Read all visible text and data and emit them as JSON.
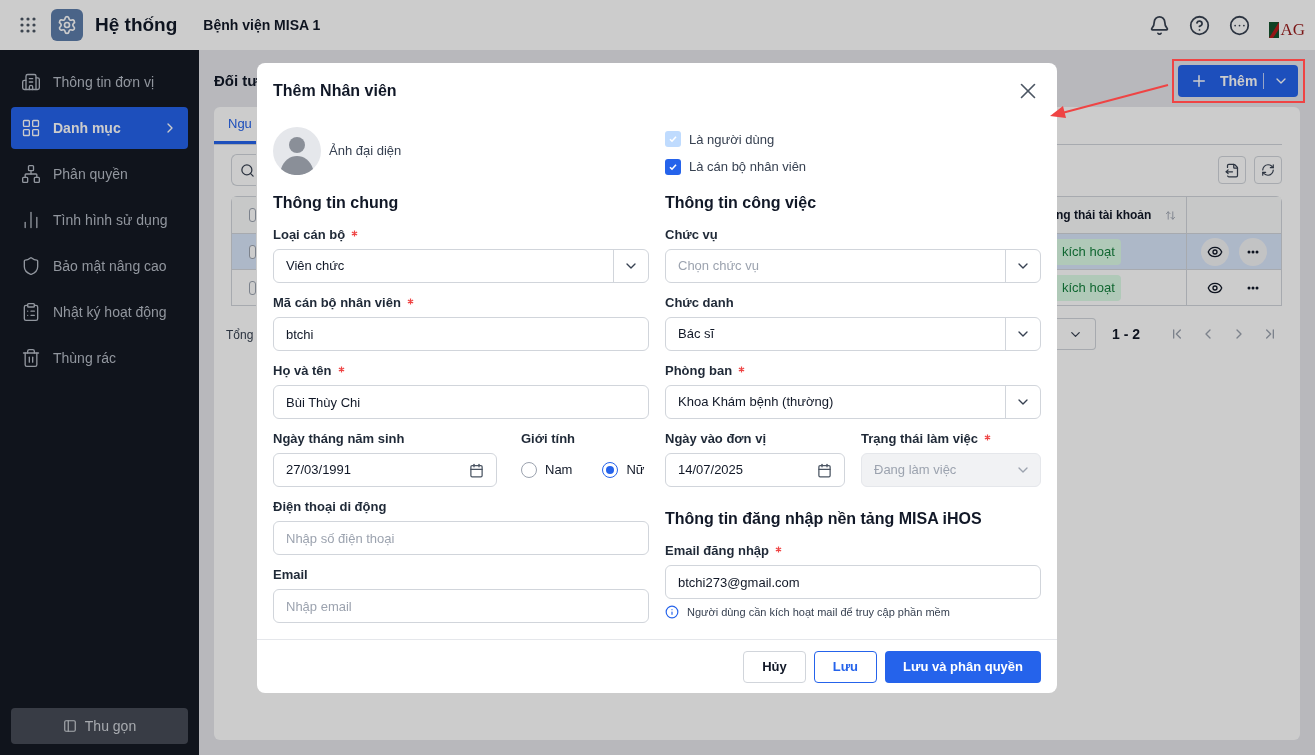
{
  "topbar": {
    "title": "Hệ thống",
    "organization": "Bệnh viện MISA 1",
    "logo_text": "AG"
  },
  "sidebar": {
    "items": [
      {
        "label": "Thông tin đơn vị",
        "selected": false
      },
      {
        "label": "Danh mục",
        "selected": true
      },
      {
        "label": "Phân quyền",
        "selected": false
      },
      {
        "label": "Tình hình sử dụng",
        "selected": false
      },
      {
        "label": "Bảo mật nâng cao",
        "selected": false
      },
      {
        "label": "Nhật ký hoạt động",
        "selected": false
      },
      {
        "label": "Thùng rác",
        "selected": false
      }
    ],
    "collapse_button": "Thu gọn"
  },
  "page": {
    "title": "Đối tư",
    "add_button": "Thêm",
    "tabs": [
      {
        "label": "Ngu",
        "selected": true
      }
    ],
    "table": {
      "column_visible": "ng thái tài khoản",
      "select_all_checked": false,
      "rows": [
        {
          "status": "kích hoạt",
          "selected": true,
          "checked": false
        },
        {
          "status": "kích hoạt",
          "selected": false,
          "checked": false
        }
      ]
    },
    "total_label": "Tổng",
    "range": "1 - 2"
  },
  "dialog": {
    "title": "Thêm Nhân viên",
    "avatar_label": "Ảnh đại diện",
    "checkboxes": [
      {
        "label": "Là người dùng",
        "checked": true,
        "disabled": true
      },
      {
        "label": "Là cán bộ nhân viên",
        "checked": true,
        "disabled": false
      }
    ],
    "columns": [
      {
        "items": [
          {
            "kind": "heading",
            "text": "Thông tin chung"
          },
          {
            "kind": "fields",
            "fields": [
              {
                "kind": "select",
                "label": "Loại cán bộ",
                "required": true,
                "value": "Viên chức",
                "disabled": false
              }
            ]
          },
          {
            "kind": "fields",
            "fields": [
              {
                "kind": "input",
                "label": "Mã cán bộ nhân viên",
                "required": true,
                "value": "btchi"
              }
            ]
          },
          {
            "kind": "fields",
            "fields": [
              {
                "kind": "input",
                "label": "Họ và tên",
                "required": true,
                "value": "Bùi Thùy Chi"
              }
            ]
          },
          {
            "kind": "fields",
            "fields": [
              {
                "kind": "date",
                "label": "Ngày tháng năm sinh",
                "required": false,
                "value": "27/03/1991"
              },
              {
                "kind": "radio",
                "label": "Giới tính",
                "required": false,
                "options": [
                  {
                    "label": "Nam",
                    "selected": false
                  },
                  {
                    "label": "Nữ",
                    "selected": true
                  }
                ]
              }
            ]
          },
          {
            "kind": "fields",
            "fields": [
              {
                "kind": "input",
                "label": "Điện thoại di động",
                "required": false,
                "placeholder": "Nhập số điện thoại"
              }
            ]
          },
          {
            "kind": "fields",
            "fields": [
              {
                "kind": "input",
                "label": "Email",
                "required": false,
                "placeholder": "Nhập email"
              }
            ]
          }
        ]
      },
      {
        "items": [
          {
            "kind": "heading",
            "text": "Thông tin công việc"
          },
          {
            "kind": "fields",
            "fields": [
              {
                "kind": "select",
                "label": "Chức vụ",
                "required": false,
                "placeholder": "Chọn chức vụ",
                "disabled": false
              }
            ]
          },
          {
            "kind": "fields",
            "fields": [
              {
                "kind": "select",
                "label": "Chức danh",
                "required": false,
                "value": "Bác sĩ",
                "disabled": false
              }
            ]
          },
          {
            "kind": "fields",
            "fields": [
              {
                "kind": "select",
                "label": "Phòng ban",
                "required": true,
                "value": "Khoa Khám bệnh (thường)",
                "disabled": false
              }
            ]
          },
          {
            "kind": "fields",
            "fields": [
              {
                "kind": "date",
                "label": "Ngày vào đơn vị",
                "required": false,
                "value": "14/07/2025"
              },
              {
                "kind": "select",
                "label": "Trạng thái làm việc",
                "required": true,
                "value": "Đang làm việc",
                "disabled": true
              }
            ]
          },
          {
            "kind": "heading",
            "text": "Thông tin đăng nhập nền tảng MISA iHOS"
          },
          {
            "kind": "fields",
            "fields": [
              {
                "kind": "input",
                "label": "Email đăng nhập",
                "required": true,
                "value": "btchi273@gmail.com"
              }
            ]
          },
          {
            "kind": "note",
            "text": "Người dùng cần kích hoạt mail để truy cập phần mềm"
          }
        ]
      }
    ],
    "buttons": [
      {
        "label": "Hủy",
        "kind": "secondary"
      },
      {
        "label": "Lưu",
        "kind": "outline"
      },
      {
        "label": "Lưu và phân quyền",
        "kind": "primary"
      }
    ]
  }
}
